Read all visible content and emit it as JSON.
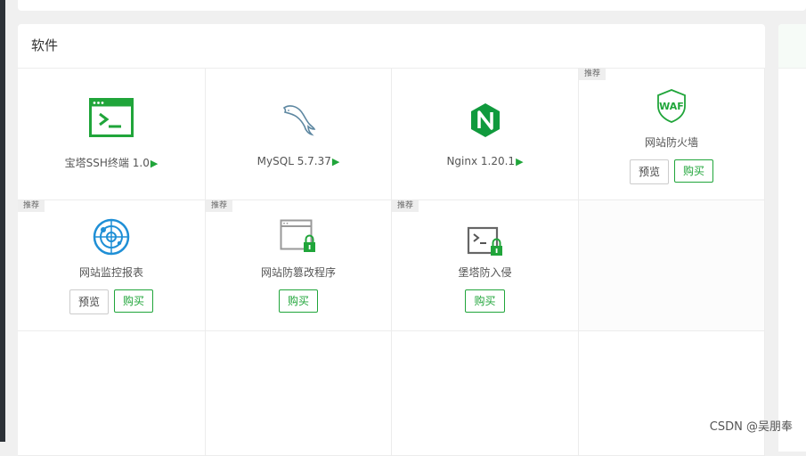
{
  "panel": {
    "title": "软件"
  },
  "tag_recommend": "推荐",
  "accent_color": "#20a53a",
  "cells": [
    {
      "name": "宝塔SSH终端 1.0",
      "icon": "terminal-icon",
      "arrow": "▶"
    },
    {
      "name": "MySQL 5.7.37",
      "icon": "mysql-dolphin-icon",
      "arrow": "▶"
    },
    {
      "name": "Nginx 1.20.1",
      "icon": "nginx-icon",
      "arrow": "▶"
    },
    {
      "name": "网站防火墙",
      "icon": "waf-shield-icon",
      "icon_text": "WAF",
      "tag": "推荐",
      "preview": "预览",
      "buy": "购买"
    },
    {
      "name": "网站监控报表",
      "icon": "radar-monitor-icon",
      "tag": "推荐",
      "preview": "预览",
      "buy": "购买"
    },
    {
      "name": "网站防篡改程序",
      "icon": "locked-window-icon",
      "tag": "推荐",
      "buy": "购买"
    },
    {
      "name": "堡塔防入侵",
      "icon": "locked-terminal-icon",
      "tag": "推荐",
      "buy": "购买"
    }
  ],
  "watermark": "CSDN @吴朋奉"
}
